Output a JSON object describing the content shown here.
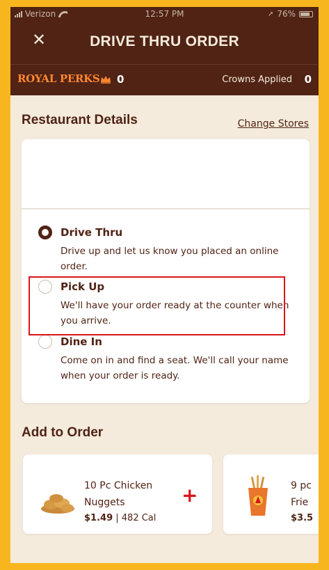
{
  "status_bar": {
    "carrier": "Verizon",
    "time": "12:57 PM",
    "battery": "76%"
  },
  "header": {
    "close_icon": "close-icon",
    "title": "DRIVE THRU ORDER"
  },
  "perks": {
    "brand": "ROYAL PERKS",
    "crowns_count": "0",
    "crowns_applied_label": "Crowns Applied",
    "crowns_applied_value": "0"
  },
  "restaurant": {
    "title": "Restaurant Details",
    "change_stores": "Change Stores",
    "options": [
      {
        "label": "Drive Thru",
        "description": "Drive up and let us know you placed an online order.",
        "selected": true
      },
      {
        "label": "Pick Up",
        "description": "We'll have your order ready at the counter when you arrive.",
        "selected": false
      },
      {
        "label": "Dine In",
        "description": "Come on in and find a seat. We'll call your name when your order is ready.",
        "selected": false
      }
    ]
  },
  "add_to_order": {
    "title": "Add to Order",
    "items": [
      {
        "name_line1": "10 Pc Chicken",
        "name_line2": "Nuggets",
        "price": "$1.49",
        "calories": "482 Cal",
        "icon": "chicken-nuggets-icon"
      },
      {
        "name_line1": "9 pc",
        "name_line2": "Frie",
        "price": "$3.5",
        "calories": "",
        "icon": "chicken-fries-icon"
      }
    ]
  },
  "colors": {
    "brand_brown": "#502314",
    "accent_orange": "#ff8732",
    "cream": "#f4ebdc",
    "highlight_red": "#d9141a",
    "frame_yellow": "#f8b61e"
  }
}
